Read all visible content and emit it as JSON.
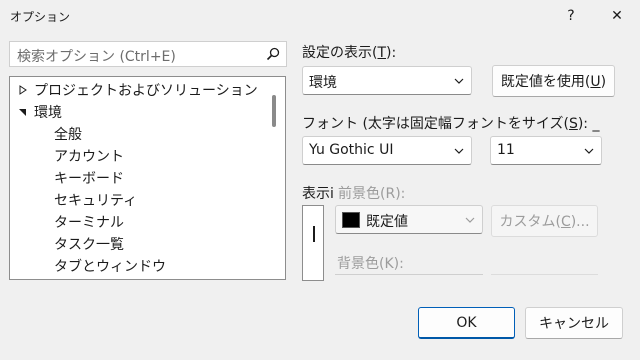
{
  "window": {
    "title": "オプション",
    "help": "?",
    "close": "✕"
  },
  "search": {
    "placeholder": "検索オプション (Ctrl+E)"
  },
  "tree": {
    "items": [
      {
        "label": "プロジェクトおよびソリューション",
        "expanded": false
      },
      {
        "label": "環境",
        "expanded": true
      },
      {
        "label": "全般"
      },
      {
        "label": "アカウント"
      },
      {
        "label": "キーボード"
      },
      {
        "label": "セキュリティ"
      },
      {
        "label": "ターミナル"
      },
      {
        "label": "タスク一覧"
      },
      {
        "label": "タブとウィンドウ"
      }
    ]
  },
  "settings": {
    "show_label_pre": "設定の表示(",
    "show_label_key": "T",
    "show_label_post": "):",
    "show_value": "環境",
    "use_default_pre": "既定値を使用(",
    "use_default_key": "U",
    "use_default_post": ")",
    "font_label_pre": "フォント (太字は固定幅フォントをサイズ(",
    "font_label_key": "S",
    "font_label_post": "): _",
    "font_value": "Yu Gothic UI",
    "size_value": "11",
    "display_label": "表示",
    "display_i": "i",
    "fg_label": "前景色(R):",
    "fg_value": "既定値",
    "custom_pre": "カスタム(",
    "custom_key": "C",
    "custom_post": ")...",
    "bg_label": "背景色(K):"
  },
  "footer": {
    "ok": "OK",
    "cancel": "キャンセル"
  },
  "colors": {
    "accent": "#005fb8",
    "swatch": "#000000"
  }
}
